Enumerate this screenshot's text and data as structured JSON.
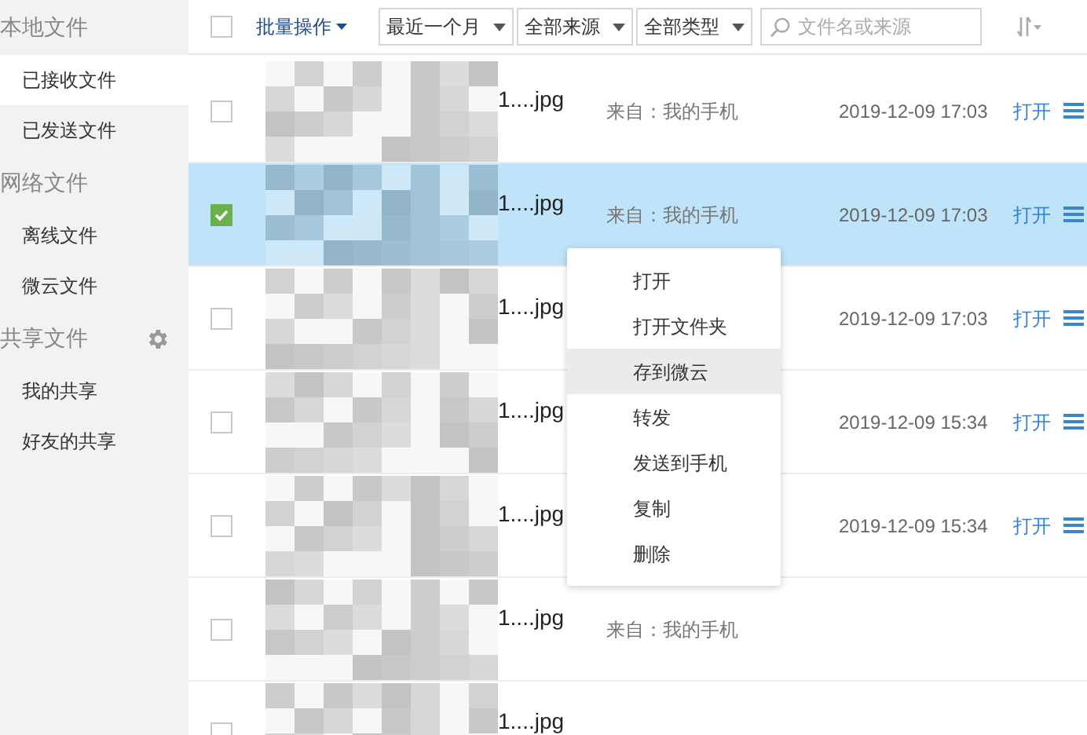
{
  "sidebar": {
    "sections": [
      {
        "title": "本地文件",
        "settings": false,
        "items": [
          {
            "label": "已接收文件",
            "selected": true
          },
          {
            "label": "已发送文件",
            "selected": false
          }
        ]
      },
      {
        "title": "网络文件",
        "settings": false,
        "items": [
          {
            "label": "离线文件",
            "selected": false
          },
          {
            "label": "微云文件",
            "selected": false
          }
        ]
      },
      {
        "title": "共享文件",
        "settings": true,
        "items": [
          {
            "label": "我的共享",
            "selected": false
          },
          {
            "label": "好友的共享",
            "selected": false
          }
        ]
      }
    ]
  },
  "toolbar": {
    "select_all": {
      "checked": false
    },
    "batch": "批量操作",
    "filters": [
      "最近一个月",
      "全部来源",
      "全部类型"
    ],
    "search": {
      "placeholder": "文件名或来源"
    }
  },
  "files": [
    {
      "name": "1....jpg",
      "source": "来自：我的手机",
      "date": "2019-12-09 17:03",
      "open": "打开",
      "selected": false
    },
    {
      "name": "1....jpg",
      "source": "来自：我的手机",
      "date": "2019-12-09 17:03",
      "open": "打开",
      "selected": true
    },
    {
      "name": "1....jpg",
      "date": "2019-12-09 17:03",
      "open": "打开",
      "selected": false
    },
    {
      "name": "1....jpg",
      "date": "2019-12-09 15:34",
      "open": "打开",
      "selected": false
    },
    {
      "name": "1....jpg",
      "date": "2019-12-09 15:34",
      "open": "打开",
      "selected": false
    },
    {
      "name": "1....jpg",
      "source": "来自：我的手机",
      "selected": false
    },
    {
      "name": "1....jpg",
      "selected": false
    }
  ],
  "context_menu": {
    "items": [
      {
        "label": "打开",
        "selected": false
      },
      {
        "label": "打开文件夹",
        "selected": false
      },
      {
        "label": "存到微云",
        "selected": true
      },
      {
        "label": "转发",
        "selected": false
      },
      {
        "label": "发送到手机",
        "selected": false
      },
      {
        "label": "复制",
        "selected": false
      },
      {
        "label": "删除",
        "selected": false
      }
    ]
  }
}
